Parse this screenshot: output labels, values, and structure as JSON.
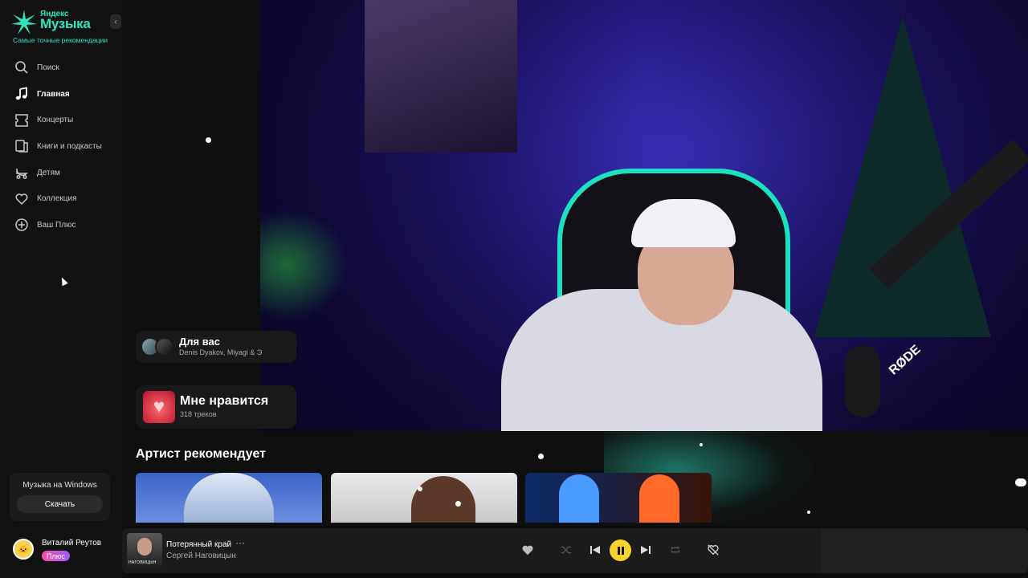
{
  "brand": {
    "small": "Яндекс",
    "name": "Музыка",
    "tagline": "Самые точные рекомендации"
  },
  "nav": [
    {
      "label": "Поиск",
      "icon": "search-icon"
    },
    {
      "label": "Главная",
      "icon": "music-note-icon",
      "active": true
    },
    {
      "label": "Концерты",
      "icon": "ticket-icon"
    },
    {
      "label": "Книги и подкасты",
      "icon": "book-icon"
    },
    {
      "label": "Детям",
      "icon": "stroller-icon"
    },
    {
      "label": "Коллекция",
      "icon": "heart-icon"
    },
    {
      "label": "Ваш Плюс",
      "icon": "plus-circle-icon"
    }
  ],
  "promo": {
    "title": "Музыка на Windows",
    "button": "Скачать"
  },
  "user": {
    "name": "Виталий Реутов",
    "badge": "Плюс"
  },
  "cards": {
    "for_you": {
      "title": "Для вас",
      "subtitle": "Denis Dyakov, Miyagi & Э"
    },
    "likes": {
      "title": "Мне нравится",
      "subtitle": "318 треков"
    }
  },
  "section": {
    "title": "Артист рекомендует"
  },
  "webcam": {
    "mic_brand": "RØDE"
  },
  "player": {
    "track": "Потерянный край",
    "artist": "Сергей Наговицын",
    "cover_text": "НАГОВИЦЫН",
    "state": "playing"
  },
  "colors": {
    "accent": "#2ee6c0",
    "play": "#f6d32d",
    "background": "#0f0f0f",
    "sidebar": "#121212"
  }
}
